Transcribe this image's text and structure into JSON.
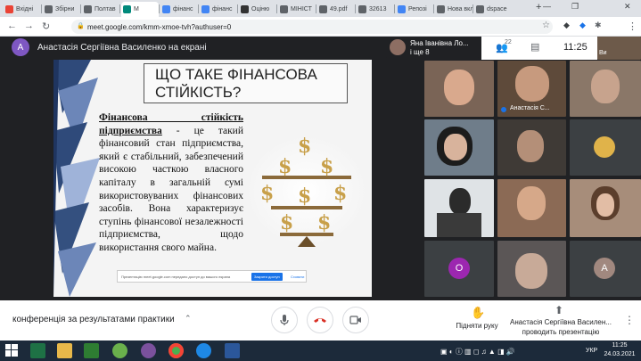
{
  "browser": {
    "tabs": [
      {
        "label": "Вхідні",
        "color": "#ea4335"
      },
      {
        "label": "Збірни",
        "color": "#5f6368"
      },
      {
        "label": "Полтав",
        "color": "#5f6368"
      },
      {
        "label": "M",
        "color": "#00897b"
      },
      {
        "label": "фінанс",
        "color": "#4285f4"
      },
      {
        "label": "фінанс",
        "color": "#4285f4"
      },
      {
        "label": "Оціню",
        "color": "#333333"
      },
      {
        "label": "МІНІСТ",
        "color": "#5f6368"
      },
      {
        "label": "49.pdf",
        "color": "#5f6368"
      },
      {
        "label": "32613",
        "color": "#5f6368"
      },
      {
        "label": "Репозі",
        "color": "#4285f4"
      },
      {
        "label": "Нова вклад",
        "color": "#5f6368"
      },
      {
        "label": "dspace",
        "color": "#5f6368"
      }
    ],
    "new_tab": "+",
    "url": "meet.google.com/kmm-xmoe-tvh?authuser=0"
  },
  "meet": {
    "presenter_initial": "A",
    "presenting_title": "Анастасія Сергіївна Василенко на екрані",
    "participants_count": "22",
    "time": "11:25",
    "top_tile_name": "Яна Іванівна Ло...",
    "top_tile_more": "і ще 8",
    "top_tile_short": "Ви",
    "speaking_name": "Анастасія С...",
    "avatar_o": "О",
    "avatar_a": "А",
    "meeting_title": "конференція за результатами практики",
    "raise_hand": "Підняти руку",
    "presenter_line1": "Анастасія Сергіївна Василен...",
    "presenter_line2": "проводить презентацію"
  },
  "slide": {
    "title": "ЩО ТАКЕ ФІНАНСОВА СТІЙКІСТЬ?",
    "term": "Фінансова стійкість підприємства",
    "body": " - це такий фінансовий стан підприємства, який є стабільний, забезпечений високою часткою власного капіталу в загальній сумі використовуваних фінансових засобів. Вона характеризує ступінь фінансової незалежності підприємства, щодо використання свого майна.",
    "share_text": "Презентацію meet.google.com передано доступ до вашого екрана",
    "share_stop": "Закрити доступ",
    "share_hide": "Сховати"
  },
  "taskbar": {
    "lang": "УКР",
    "time": "11:25",
    "date": "24.03.2021"
  }
}
